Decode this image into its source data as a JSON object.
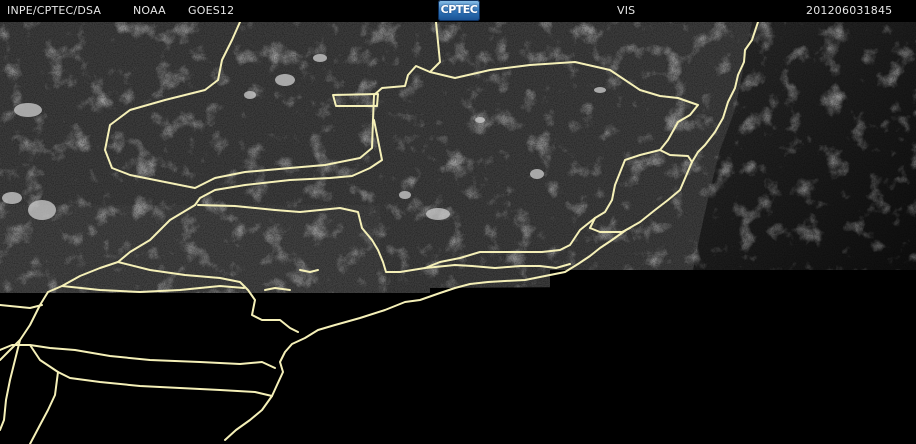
{
  "header": {
    "institution": "INPE/CPTEC/DSA",
    "agency": "NOAA",
    "satellite": "GOES12",
    "logo_text": "CPTEC",
    "channel": "VIS",
    "timestamp": "201206031845"
  },
  "colors": {
    "background": "#000000",
    "header_text": "#e6e6e6",
    "border_lines": "#f5f0b8",
    "land_imagery": "#3a3a3a",
    "logo_blue": "#2e73b8"
  }
}
